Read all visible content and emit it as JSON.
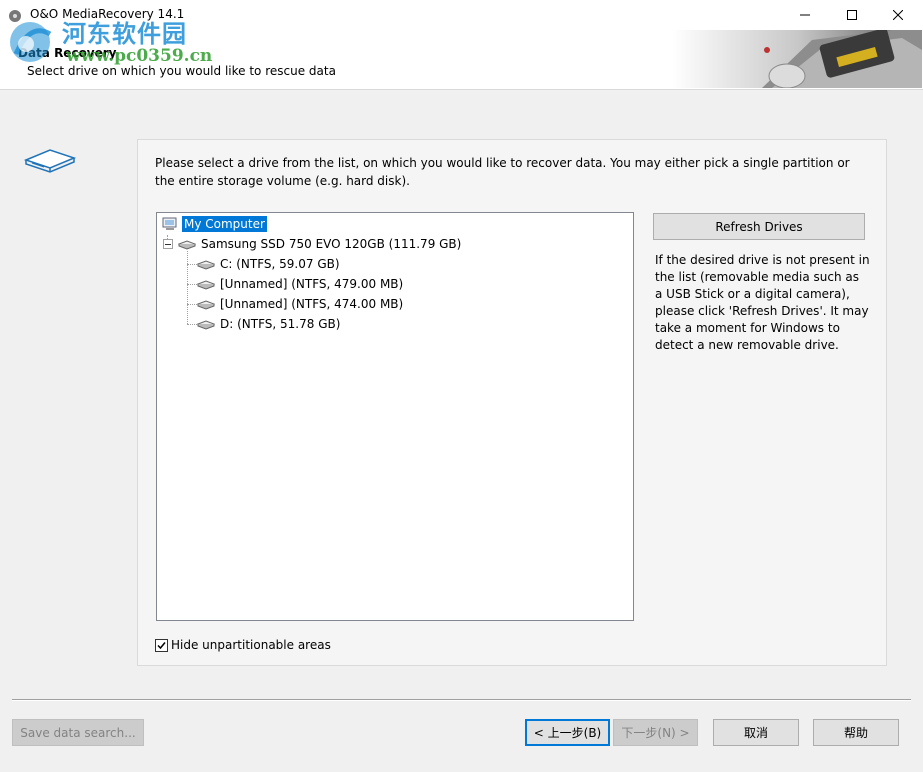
{
  "window": {
    "title": "O&O MediaRecovery 14.1"
  },
  "watermark": {
    "line1": "河东软件园",
    "line2": "www.pc0359.cn"
  },
  "header": {
    "title": "Data Recovery",
    "subtitle": "Select drive on which you would like to rescue data"
  },
  "instructions": "Please select a drive from the list, on which you would like to recover data. You may either pick a single partition or the entire storage volume (e.g. hard disk).",
  "tree": {
    "root": "My Computer",
    "disk": "Samsung SSD 750 EVO 120GB (111.79 GB)",
    "partitions": [
      "C: (NTFS, 59.07 GB)",
      "[Unnamed] (NTFS, 479.00 MB)",
      "[Unnamed] (NTFS, 474.00 MB)",
      "D: (NTFS, 51.78 GB)"
    ]
  },
  "refresh": {
    "label": "Refresh Drives",
    "help": "If the desired drive is not present in the list (removable media such as a USB Stick or a digital camera), please click 'Refresh Drives'. It may take a moment for Windows to detect a new removable drive."
  },
  "hide_checkbox": {
    "label": "Hide unpartitionable areas",
    "checked": true
  },
  "buttons": {
    "save_search": "Save data search...",
    "prev": "< 上一步(B)",
    "next": "下一步(N) >",
    "cancel": "取消",
    "help": "帮助"
  },
  "colors": {
    "selection": "#0078d7",
    "accent": "#0078d7"
  }
}
